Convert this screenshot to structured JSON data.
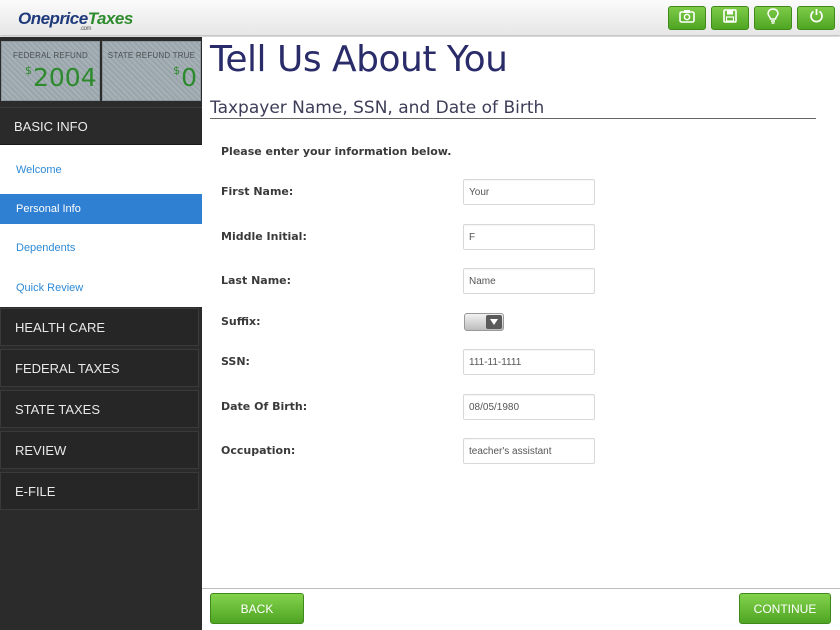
{
  "app": {
    "logo_main": "Oneprice",
    "logo_accent": "Taxes",
    "logo_suffix": ".com"
  },
  "toolbar": {
    "buttons": [
      {
        "name": "camera-button",
        "icon": "camera-icon"
      },
      {
        "name": "save-button",
        "icon": "floppy-disk-icon"
      },
      {
        "name": "tips-button",
        "icon": "lightbulb-icon"
      },
      {
        "name": "power-button",
        "icon": "power-icon"
      }
    ],
    "accent_color": "#5cb82e"
  },
  "refunds": {
    "federal_label": "FEDERAL REFUND",
    "federal_currency": "$",
    "federal_amount": "2004",
    "state_label": "STATE REFUND TRUE",
    "state_currency": "$",
    "state_amount": "0"
  },
  "sidebar": {
    "basic_info_label": "BASIC INFO",
    "subitems": [
      "Welcome",
      "Personal Info",
      "Dependents",
      "Quick Review"
    ],
    "selected_subitem": "Personal Info",
    "sections": [
      "HEALTH CARE",
      "FEDERAL TAXES",
      "STATE TAXES",
      "REVIEW",
      "E-FILE"
    ]
  },
  "main": {
    "title": "Tell Us About You",
    "subtitle": "Taxpayer Name, SSN, and Date of Birth",
    "instruction": "Please enter your information below.",
    "fields": {
      "first_name": {
        "label": "First Name:",
        "value": "Your"
      },
      "middle_initial": {
        "label": "Middle Initial:",
        "value": "F"
      },
      "last_name": {
        "label": "Last Name:",
        "value": "Name"
      },
      "suffix": {
        "label": "Suffix:",
        "value": ""
      },
      "ssn": {
        "label": "SSN:",
        "value": "111-11-1111"
      },
      "dob": {
        "label": "Date Of Birth:",
        "value": "08/05/1980"
      },
      "occupation": {
        "label": "Occupation:",
        "value": "teacher's assistant"
      }
    }
  },
  "footer": {
    "back_label": "BACK",
    "continue_label": "CONTINUE"
  }
}
